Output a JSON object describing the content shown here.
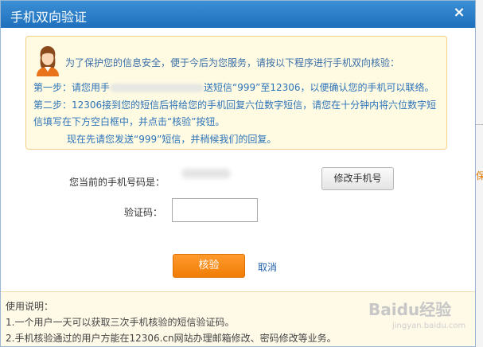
{
  "dialog": {
    "title": "手机双向验证",
    "close_label": "×"
  },
  "notice": {
    "intro": "为了保护您的信息安全，便于今后为您服务，请按以下程序进行手机双向核验：",
    "step1_prefix": "第一步：请您用手",
    "step1_suffix": "送短信“999”至12306，以便确认您的手机可以联络。",
    "step2_line1": "第二步：12306接到您的短信后将给您的手机回复六位数字短信，请您在十分钟内将六位数字短",
    "step2_line2": "信填写在下方空白框中，并点击“核验”按钮。",
    "now": "现在先请您发送“999”短信，并稍候我们的回复。"
  },
  "form": {
    "phone_label": "您当前的手机号码是：",
    "change_phone_button": "修改手机号",
    "code_label": "验证码：",
    "code_value": "",
    "verify_button": "核验",
    "cancel_link": "取消"
  },
  "footer": {
    "title": "使用说明：",
    "rule1": "1.一个用户一天可以获取三次手机核验的短信验证码。",
    "rule2": "2.手机核验通过的用户方能在12306.cn网站办理邮箱修改、密码修改等业务。"
  },
  "watermark": {
    "brand": "Baidu经验",
    "url": "jingyan.baidu.com"
  },
  "background": {
    "fragment": "保"
  },
  "colors": {
    "titlebar": "#1f70bd",
    "accent_orange": "#f07d05",
    "notice_bg": "#fffbe3",
    "link_blue": "#1f5fab"
  }
}
